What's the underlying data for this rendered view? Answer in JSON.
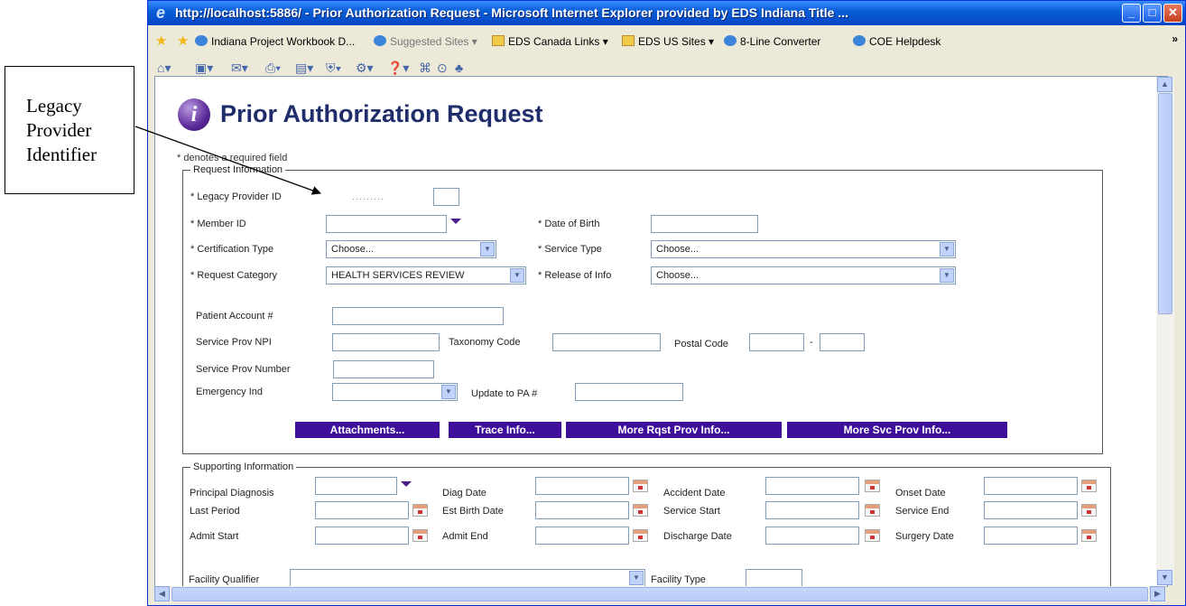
{
  "callout": {
    "lines": [
      "Legacy",
      "Provider",
      "Identifier"
    ]
  },
  "window": {
    "title": "http://localhost:5886/ - Prior Authorization Request - Microsoft Internet Explorer provided by EDS Indiana Title ...",
    "buttons": {
      "minimize": "_",
      "maximize": "□",
      "close": "✕"
    }
  },
  "links_bar": {
    "items": [
      {
        "label": "Indiana Project Workbook D...",
        "icon": "ie-icon"
      },
      {
        "label": "Suggested Sites ▾",
        "icon": "ie-icon"
      },
      {
        "label": "EDS Canada Links ▾",
        "icon": "folder-icon"
      },
      {
        "label": "EDS US Sites ▾",
        "icon": "folder-icon"
      },
      {
        "label": "8-Line Converter",
        "icon": "ie-icon"
      },
      {
        "label": "COE Helpdesk",
        "icon": "ie-icon"
      }
    ],
    "overflow": "»"
  },
  "page": {
    "title": "Prior Authorization Request",
    "logo_letter": "i",
    "required_note": "* denotes a required field"
  },
  "request_info": {
    "legend": "Request Information",
    "legacy_provider_id": {
      "label": "* Legacy Provider ID",
      "masked_value": "·········"
    },
    "member_id": {
      "label": "* Member ID"
    },
    "date_of_birth": {
      "label": "* Date of Birth"
    },
    "certification_type": {
      "label": "* Certification Type",
      "value": "Choose..."
    },
    "service_type": {
      "label": "* Service Type",
      "value": "Choose..."
    },
    "request_category": {
      "label": "* Request Category",
      "value": "HEALTH SERVICES REVIEW"
    },
    "release_of_info": {
      "label": "* Release of Info",
      "value": "Choose..."
    },
    "patient_account": {
      "label": "Patient Account #"
    },
    "service_prov_npi": {
      "label": "Service Prov NPI"
    },
    "taxonomy_code": {
      "label": "Taxonomy Code"
    },
    "postal_code": {
      "label": "Postal Code",
      "separator": "-"
    },
    "service_prov_number": {
      "label": "Service Prov Number"
    },
    "emergency_ind": {
      "label": "Emergency Ind",
      "value": ""
    },
    "update_to_pa": {
      "label": "Update to PA #"
    },
    "buttons": {
      "attachments": "Attachments...",
      "trace_info": "Trace Info...",
      "more_rqst_prov": "More Rqst Prov Info...",
      "more_svc_prov": "More Svc Prov Info..."
    }
  },
  "supporting_info": {
    "legend": "Supporting Information",
    "row1": [
      "Principal Diagnosis",
      "Diag Date",
      "Accident Date",
      "Onset Date"
    ],
    "row2": [
      "Last Period",
      "Est Birth Date",
      "Service Start",
      "Service End"
    ],
    "row3": [
      "Admit Start",
      "Admit End",
      "Discharge Date",
      "Surgery Date"
    ],
    "facility_qualifier": {
      "label": "Facility Qualifier",
      "value": ""
    },
    "facility_type": {
      "label": "Facility Type"
    }
  },
  "colors": {
    "accent_purple": "#3f0f9b",
    "title_blue": "#1f2d6b",
    "xp_titlebar": "#0a5fd8"
  }
}
